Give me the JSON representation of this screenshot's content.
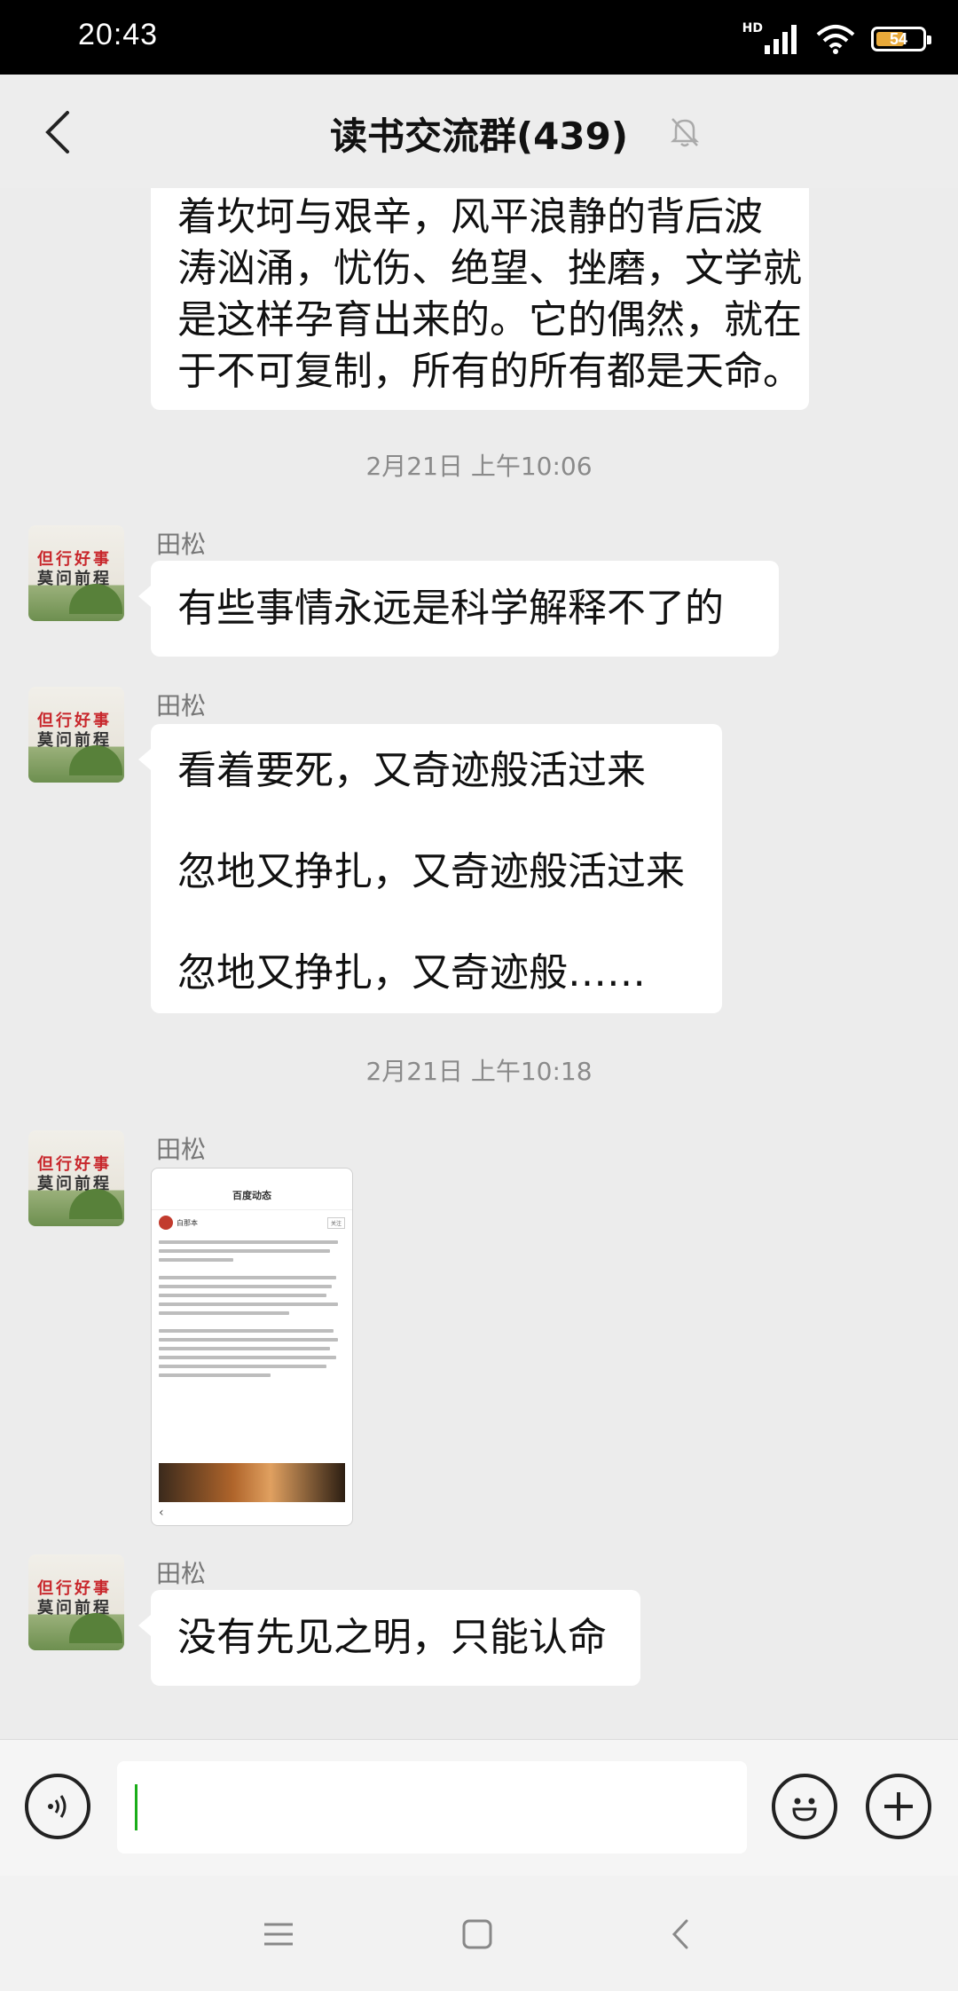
{
  "status_bar": {
    "time": "20:43",
    "network": "HD",
    "battery_level": "54"
  },
  "header": {
    "title": "读书交流群(439)"
  },
  "messages": {
    "top_bubble_lines": [
      "着坎坷与艰辛，风平浪静的背后波",
      "涛汹涌，忧伤、绝望、挫磨，文学就",
      "是这样孕育出来的。它的偶然，就在",
      "于不可复制，所有的所有都是天命。"
    ],
    "timestamp_1": "2月21日 上午10:06",
    "msg1": {
      "sender": "田松",
      "text": "有些事情永远是科学解释不了的"
    },
    "msg2": {
      "sender": "田松",
      "line1": "看着要死，又奇迹般活过来",
      "line2": "忽地又挣扎，又奇迹般活过来",
      "line3": "忽地又挣扎，又奇迹般……"
    },
    "timestamp_2": "2月21日 上午10:18",
    "msg3": {
      "sender": "田松",
      "image_title": "百度动态",
      "image_author": "白那本",
      "image_follow": "关注"
    },
    "msg4": {
      "sender": "田松",
      "text": "没有先见之明，只能认命"
    },
    "avatar": {
      "line1": "但行好事",
      "line2": "莫问前程"
    }
  },
  "input": {
    "placeholder": ""
  },
  "icons": {
    "back": "chevron-left-icon",
    "mute": "bell-off-icon",
    "voice": "voice-icon",
    "emoji": "emoji-icon",
    "plus": "plus-icon"
  }
}
